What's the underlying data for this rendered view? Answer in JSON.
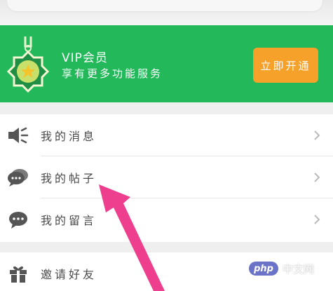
{
  "vip": {
    "title": "VIP会员",
    "subtitle": "享有更多功能服务",
    "button_label": "立即开通"
  },
  "menu": {
    "items": [
      {
        "label": "我的消息",
        "icon": "speaker-icon"
      },
      {
        "label": "我的帖子",
        "icon": "chat-bubbles-icon"
      },
      {
        "label": "我的留言",
        "icon": "comment-icon"
      },
      {
        "label": "邀请好友",
        "icon": "gift-icon"
      }
    ]
  },
  "watermark": {
    "logo_text": "php",
    "text": "中文网"
  },
  "colors": {
    "banner_green": "#23b85a",
    "button_orange": "#f6a12a",
    "annotation_arrow": "#ee3f8e"
  }
}
